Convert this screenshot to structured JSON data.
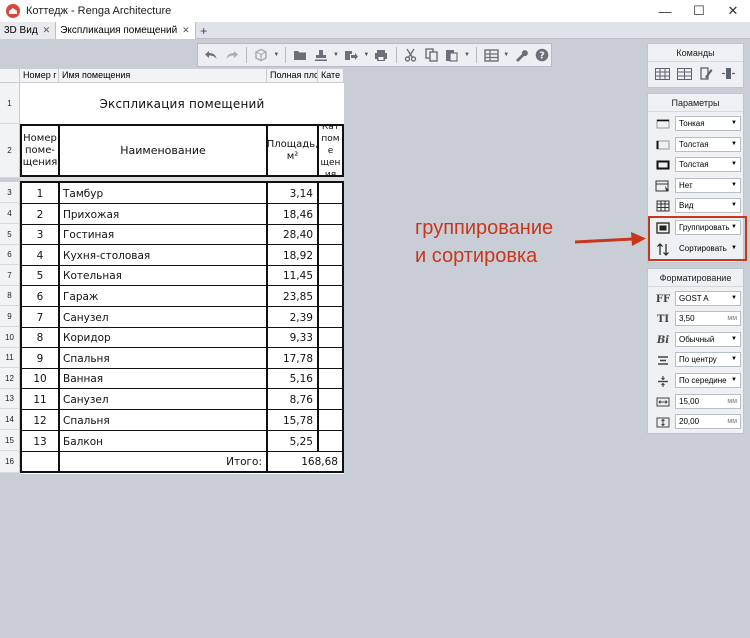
{
  "window": {
    "title": "Коттедж - Renga Architecture",
    "minimize": "—",
    "maximize": "☐",
    "close": "✕"
  },
  "tabs": [
    {
      "label": "3D Вид",
      "close": "✕"
    },
    {
      "label": "Экспликация помещений",
      "close": "✕"
    }
  ],
  "tab_add": "+",
  "toolbar": {
    "icons": [
      "undo-icon",
      "redo-icon",
      "view-icon",
      "folder-icon",
      "stamp-icon",
      "export-icon",
      "print-icon",
      "cut-icon",
      "copy-icon",
      "paste-icon",
      "table-icon",
      "wrench-icon",
      "help-icon"
    ]
  },
  "column_headers": [
    "Номер г",
    "Имя помещения",
    "Полная плс",
    "Кате"
  ],
  "row_numbers": [
    "1",
    "2",
    "3",
    "4",
    "5",
    "6",
    "7",
    "8",
    "9",
    "10",
    "11",
    "12",
    "13",
    "14",
    "15",
    "16"
  ],
  "document": {
    "title": "Экспликация помещений",
    "header": {
      "number": "Номер поме- щения",
      "name": "Наименование",
      "area": "Площадь, м²",
      "category": "Кат поме щения"
    },
    "rows": [
      {
        "num": "1",
        "name": "Тамбур",
        "area": "3,14"
      },
      {
        "num": "2",
        "name": "Прихожая",
        "area": "18,46"
      },
      {
        "num": "3",
        "name": "Гостиная",
        "area": "28,40"
      },
      {
        "num": "4",
        "name": "Кухня-столовая",
        "area": "18,92"
      },
      {
        "num": "5",
        "name": "Котельная",
        "area": "11,45"
      },
      {
        "num": "6",
        "name": "Гараж",
        "area": "23,85"
      },
      {
        "num": "7",
        "name": "Санузел",
        "area": "2,39"
      },
      {
        "num": "8",
        "name": "Коридор",
        "area": "9,33"
      },
      {
        "num": "9",
        "name": "Спальня",
        "area": "17,78"
      },
      {
        "num": "10",
        "name": "Ванная",
        "area": "5,16"
      },
      {
        "num": "11",
        "name": "Санузел",
        "area": "8,76"
      },
      {
        "num": "12",
        "name": "Спальня",
        "area": "15,78"
      },
      {
        "num": "13",
        "name": "Балкон",
        "area": "5,25"
      }
    ],
    "total_label": "Итого:",
    "total_value": "168,68"
  },
  "commands_panel": {
    "title": "Команды",
    "icons": [
      "insert-table-icon",
      "columns-icon",
      "edit-icon",
      "column-width-icon"
    ]
  },
  "params_panel": {
    "title": "Параметры",
    "items": [
      {
        "icon": "line-thin-icon",
        "value": "Тонкая"
      },
      {
        "icon": "line-thick-side-icon",
        "value": "Толстая"
      },
      {
        "icon": "line-thick-frame-icon",
        "value": "Толстая"
      },
      {
        "icon": "header-icon",
        "value": "Нет"
      },
      {
        "icon": "view-grid-icon",
        "value": "Вид"
      },
      {
        "icon": "group-icon",
        "value": "Группировать"
      },
      {
        "icon": "sort-icon",
        "value": "Сортировать"
      }
    ]
  },
  "format_panel": {
    "title": "Форматирование",
    "font_label": "FF",
    "font": "GOST A",
    "size_label": "TI",
    "size": "3,50",
    "size_unit": "мм",
    "style_label": "Bi",
    "style": "Обычный",
    "halign": "По центру",
    "valign": "По середине",
    "width": "15,00",
    "width_unit": "мм",
    "height": "20,00",
    "height_unit": "мм"
  },
  "annotation": {
    "line1": "группирование",
    "line2": "и сортировка",
    "color": "#c9361c"
  }
}
